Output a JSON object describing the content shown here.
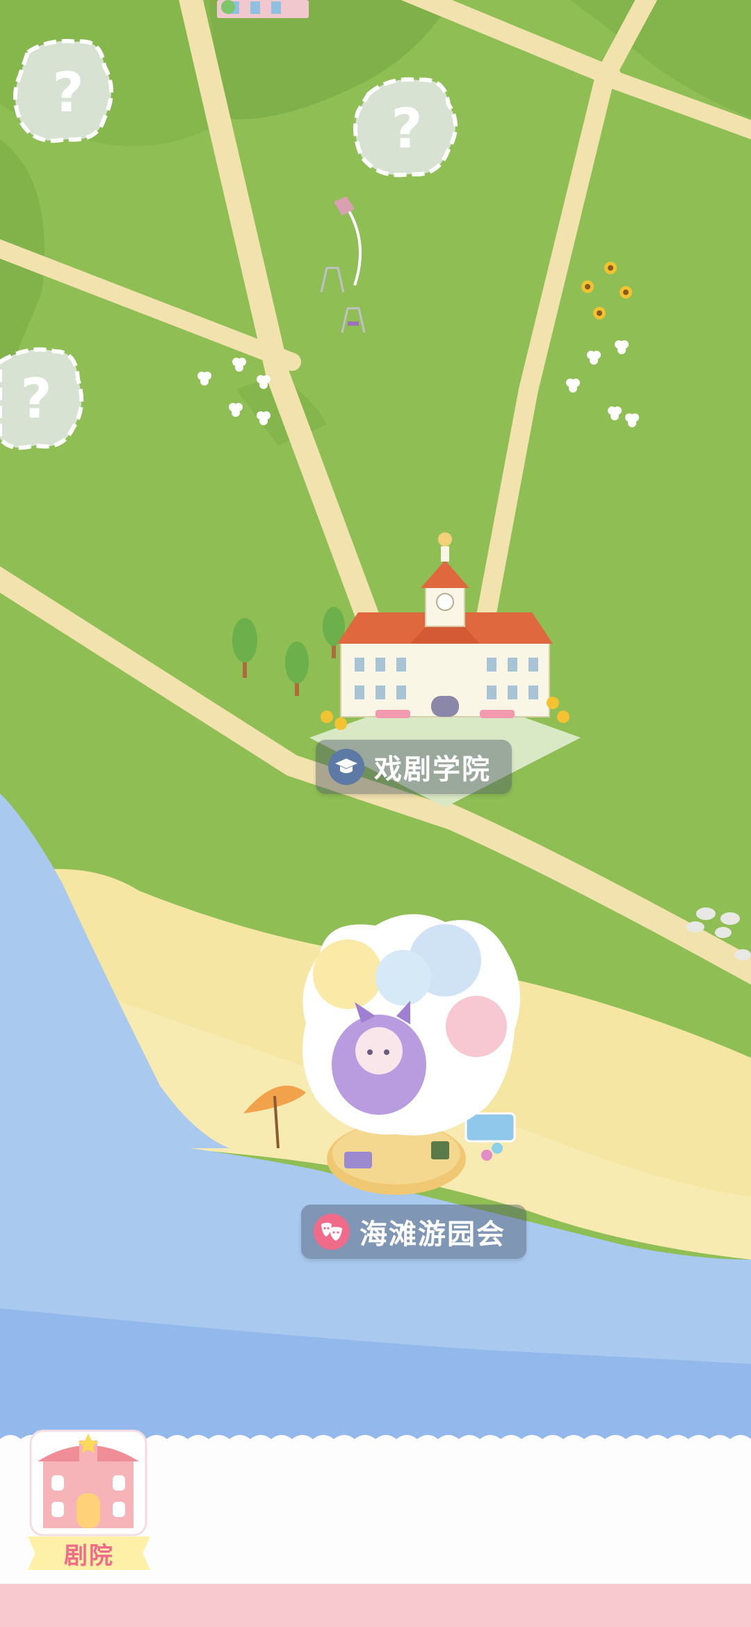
{
  "map": {
    "locations": [
      {
        "name": "戏剧学院",
        "icon": "graduation-cap-icon",
        "locked": false
      },
      {
        "name": "海滩游园会",
        "icon": "theater-masks-icon",
        "locked": false
      }
    ],
    "locked_plots": [
      "?",
      "?",
      "?"
    ]
  },
  "bottom_nav": {
    "theater_label": "剧院",
    "theater_icon": "theater-building-icon"
  },
  "colors": {
    "grass": "#8fbe55",
    "grass_dark": "#7eae48",
    "path": "#f3e3b0",
    "beach": "#f5e6a3",
    "water": "#a9c9ef",
    "water_deep": "#92b6ec",
    "accent_pink": "#f06b8a"
  }
}
